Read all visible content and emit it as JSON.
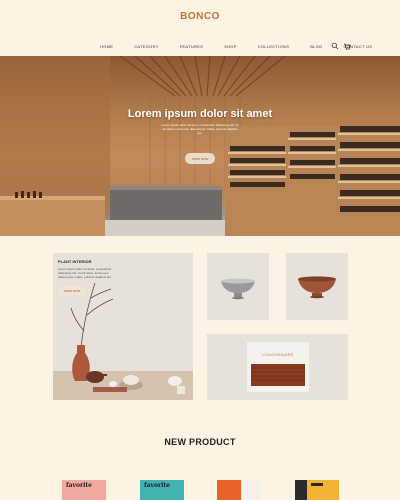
{
  "brand": {
    "logo": "BONCO",
    "accent_color": "#c0713d"
  },
  "nav": {
    "items": [
      "HOME",
      "CATEGORY",
      "FEATURES",
      "SHOP",
      "COLLECTIONS",
      "BLOG",
      "CONTACT US"
    ],
    "icons": [
      "search-icon",
      "cart-icon"
    ]
  },
  "hero": {
    "title": "Lorem ipsum dolor sit amet",
    "subtitle": "Lorem ipsum dolor sit amet, consectetur adipiscing elit. Ut elit tellus, luctus nec ullamcorper mattis, pulvinar dapibus leo.",
    "button": "SHOP NOW"
  },
  "promo": {
    "title": "PLANT INTERIOR",
    "text": "Lorem ipsum dolor sit amet, consectetur adipiscing elit. Ut elit tellus, luctus nec ullamcorper mattis, pulvinar dapibus leo.",
    "button": "SHOP NOW"
  },
  "product_box": {
    "brand_text": "LOUGHENARE"
  },
  "new_product": {
    "title": "NEW PRODUCT",
    "items": [
      {
        "label": "favorite",
        "color": "#f2a9a0"
      },
      {
        "label": "favorite",
        "color": "#3fb3b0"
      },
      {
        "label": "",
        "color": "#e8622a"
      },
      {
        "label": "",
        "color": "#2b2b2b"
      }
    ]
  }
}
